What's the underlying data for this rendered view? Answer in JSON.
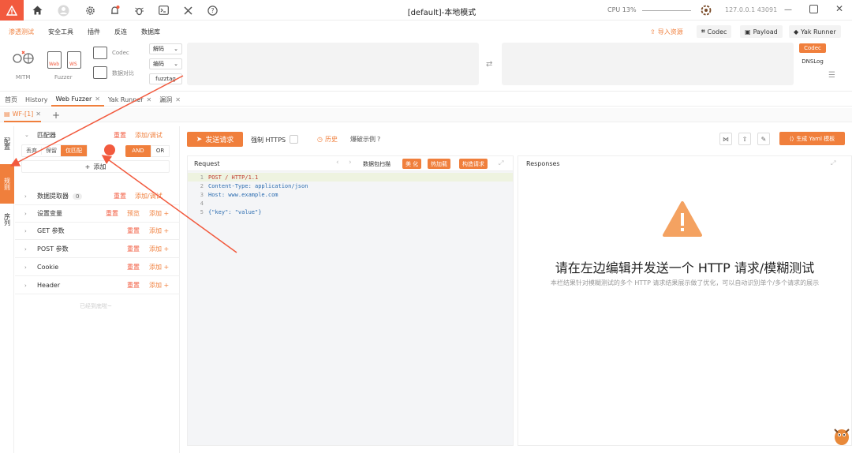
{
  "window": {
    "title": "[default]-本地模式",
    "cpu": "CPU 13%",
    "host": "127.0.0.1 43091"
  },
  "menu": {
    "tabs": [
      "渗透测试",
      "安全工具",
      "插件",
      "反连",
      "数据库"
    ],
    "right_buttons": [
      "导入资源",
      "Codec",
      "Payload",
      "Yak Runner"
    ]
  },
  "toolbar": {
    "mitm": "MITM",
    "web_label": "Web",
    "ws_label": "WS",
    "fuzzer": "Fuzzer",
    "codec": "Codec",
    "compare": "数据对比",
    "decode": "解码",
    "encode": "编码",
    "fuzztag": "fuzztag",
    "codec_tag": "Codec",
    "dnslog_tag": "DNSLog"
  },
  "page_tabs": [
    {
      "label": "首页",
      "closable": false
    },
    {
      "label": "History",
      "closable": false
    },
    {
      "label": "Web Fuzzer",
      "closable": true
    },
    {
      "label": "Yak Runner",
      "closable": true
    },
    {
      "label": "漏洞",
      "closable": true
    }
  ],
  "sub_tab": "WF-[1]",
  "rail": [
    "配置",
    "规则",
    "序列"
  ],
  "left_panel": {
    "matcher": {
      "title": "匹配器",
      "reset": "重置",
      "add_debug": "添加/调试",
      "mode_buttons": [
        "丢弃",
        "保留",
        "仅匹配"
      ],
      "logic": [
        "AND",
        "OR"
      ],
      "add": "添加"
    },
    "sections": [
      {
        "name": "数据提取器",
        "badge": "0",
        "actions": [
          "重置",
          "添加/调试"
        ]
      },
      {
        "name": "设置变量",
        "actions": [
          "重置",
          "预览",
          "添加"
        ]
      },
      {
        "name": "GET 参数",
        "actions": [
          "重置",
          "添加"
        ]
      },
      {
        "name": "POST 参数",
        "actions": [
          "重置",
          "添加"
        ]
      },
      {
        "name": "Cookie",
        "actions": [
          "重置",
          "添加"
        ]
      },
      {
        "name": "Header",
        "actions": [
          "重置",
          "添加"
        ]
      }
    ],
    "bottom_hint": "已经到底啦~"
  },
  "main": {
    "send": "发送请求",
    "force_https": "强制 HTTPS",
    "history": "历史",
    "examples": "爆破示例",
    "gen_yaml": "生成 Yaml 模板"
  },
  "request": {
    "title": "Request",
    "scan": "数据包扫描",
    "buttons": [
      "美 化",
      "热加载",
      "构造请求"
    ],
    "lines": [
      {
        "n": "1",
        "text": "POST / HTTP/1.1"
      },
      {
        "n": "2",
        "text": "Content-Type: application/json"
      },
      {
        "n": "3",
        "text": "Host: www.example.com"
      },
      {
        "n": "4",
        "text": ""
      },
      {
        "n": "5",
        "text": "{\"key\": \"value\"}"
      }
    ]
  },
  "response": {
    "title": "Responses",
    "headline": "请在左边编辑并发送一个 HTTP 请求/模糊测试",
    "desc": "本栏结果针对模糊测试的多个 HTTP 请求结果展示做了优化，可以自动识别单个/多个请求的展示"
  },
  "colors": {
    "accent": "#f07f3c",
    "danger": "#f25a3e"
  }
}
